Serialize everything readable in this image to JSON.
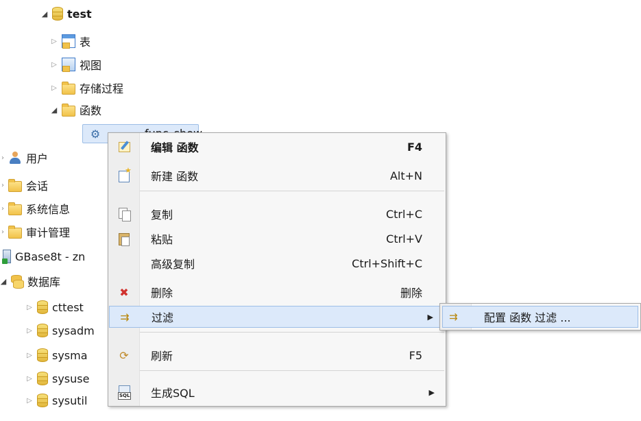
{
  "tree": {
    "test_db": "test",
    "tables": "表",
    "views": "视图",
    "procedures": "存储过程",
    "functions": "函数",
    "function_item": "func_show",
    "users": "用户",
    "sessions": "会话",
    "sysinfo": "系统信息",
    "audit": "审计管理",
    "server": "GBase8t - zn",
    "databases": "数据库",
    "db_items": [
      "cttest",
      "sysadm",
      "sysma",
      "sysuse",
      "sysutil"
    ]
  },
  "context_menu": {
    "items": [
      {
        "label": "编辑 函数",
        "shortcut": "F4",
        "icon": "edit-icon"
      },
      {
        "label": "新建 函数",
        "shortcut": "Alt+N",
        "icon": "new-icon"
      },
      {
        "label": "复制",
        "shortcut": "Ctrl+C",
        "icon": "copy-icon"
      },
      {
        "label": "粘贴",
        "shortcut": "Ctrl+V",
        "icon": "paste-icon"
      },
      {
        "label": "高级复制",
        "shortcut": "Ctrl+Shift+C",
        "icon": ""
      },
      {
        "label": "删除",
        "shortcut": "删除",
        "icon": "delete-icon"
      },
      {
        "label": "过滤",
        "shortcut": "",
        "icon": "filter-icon",
        "submenu": true
      },
      {
        "label": "刷新",
        "shortcut": "F5",
        "icon": "refresh-icon"
      },
      {
        "label": "生成SQL",
        "shortcut": "",
        "icon": "sql-icon",
        "submenu": true
      }
    ]
  },
  "submenu": {
    "item": "配置 函数 过滤 ..."
  },
  "colors": {
    "highlight_bg": "#dce9fa",
    "highlight_border": "#9cbde6",
    "menu_bg": "#f7f7f7",
    "delete_icon": "#d0312d"
  }
}
